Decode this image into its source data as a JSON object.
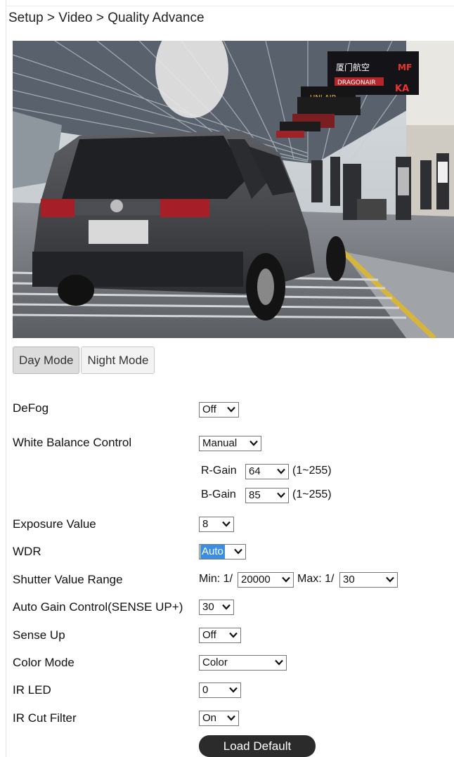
{
  "breadcrumb": "Setup > Video > Quality Advance",
  "preview": {
    "sign1_line1": "厦门航空",
    "sign1_tag": "MF",
    "sign1_line2": "DRAGONAIR",
    "sign1_tag2": "KA",
    "sign2": "UNI AIR"
  },
  "tabs": {
    "day": "Day Mode",
    "night": "Night Mode"
  },
  "rows": {
    "defog": {
      "label": "DeFog",
      "value": "Off"
    },
    "white_balance": {
      "label": "White Balance Control",
      "value": "Manual"
    },
    "r_gain": {
      "label": "R-Gain",
      "value": "64",
      "range": "(1~255)"
    },
    "b_gain": {
      "label": "B-Gain",
      "value": "85",
      "range": "(1~255)"
    },
    "exposure": {
      "label": "Exposure Value",
      "value": "8"
    },
    "wdr": {
      "label": "WDR",
      "value": "Auto"
    },
    "shutter": {
      "label": "Shutter Value Range",
      "min_label": "Min: 1/",
      "min_value": "20000",
      "max_label": "Max: 1/",
      "max_value": "30"
    },
    "agc": {
      "label": "Auto Gain Control(SENSE UP+)",
      "value": "30"
    },
    "sense_up": {
      "label": "Sense Up",
      "value": "Off"
    },
    "color_mode": {
      "label": "Color Mode",
      "value": "Color"
    },
    "ir_led": {
      "label": "IR LED",
      "value": "0"
    },
    "ir_cut": {
      "label": "IR Cut Filter",
      "value": "On"
    }
  },
  "load_default": "Load Default",
  "colors": {
    "button_bg": "#2b2b2b",
    "focus": "#3a8ee6"
  },
  "icons": {
    "dropdown": "chevron-down-icon"
  }
}
